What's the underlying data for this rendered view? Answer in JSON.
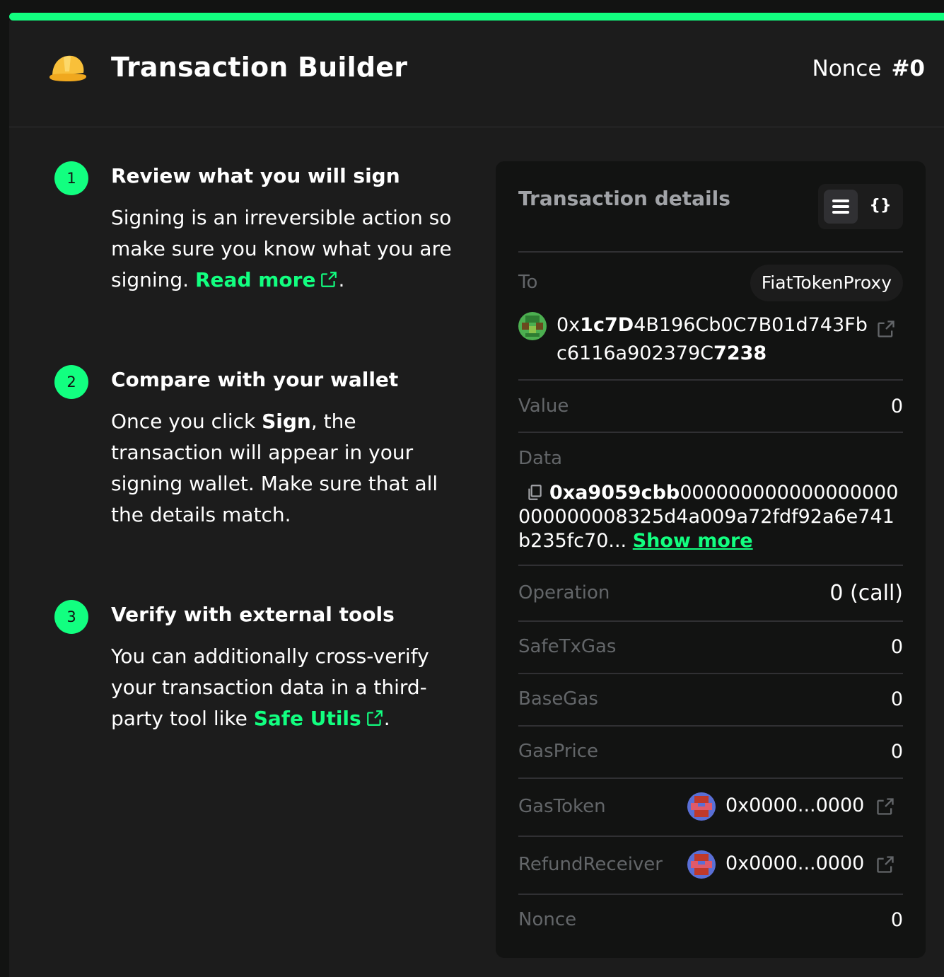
{
  "header": {
    "title": "Transaction Builder",
    "app_icon": "hard-hat-icon",
    "nonce_label": "Nonce",
    "nonce_value": "#0"
  },
  "steps": [
    {
      "number": "1",
      "title": "Review what you will sign",
      "body": "Signing is an irreversible action so make sure you know what you are signing.",
      "link": "Read more",
      "after": "."
    },
    {
      "number": "2",
      "title": "Compare with your wallet",
      "body_before": "Once you click",
      "body_bold": "Sign",
      "body_after": ", the transaction will appear in your signing wallet. Make sure that all the details match."
    },
    {
      "number": "3",
      "title": "Verify with external tools",
      "body": "You can additionally cross-verify your transaction data in a third-party tool like",
      "link": "Safe Utils",
      "after": "."
    }
  ],
  "details": {
    "title": "Transaction details",
    "to": {
      "label": "To",
      "name": "FiatTokenProxy",
      "addr_prefix": "0x",
      "addr_bold_start": "1c7D",
      "addr_middle": "4B196Cb0C7B01d743Fbc6116a902379C",
      "addr_bold_end": "7238"
    },
    "value": {
      "label": "Value",
      "value": "0"
    },
    "data": {
      "label": "Data",
      "hex_bold": "0xa9059cbb",
      "hex_rest": "000000000000000000000000008325d4a009a72fdf92a6e741b235fc70...",
      "show_more": "Show more"
    },
    "operation": {
      "label": "Operation",
      "value": "0 (call)"
    },
    "safe_tx_gas": {
      "label": "SafeTxGas",
      "value": "0"
    },
    "base_gas": {
      "label": "BaseGas",
      "value": "0"
    },
    "gas_price": {
      "label": "GasPrice",
      "value": "0"
    },
    "gas_token": {
      "label": "GasToken",
      "value": "0x0000...0000"
    },
    "refund_receiver": {
      "label": "RefundReceiver",
      "value": "0x0000...0000"
    },
    "nonce": {
      "label": "Nonce",
      "value": "0"
    }
  },
  "colors": {
    "accent": "#12ff80",
    "background": "#1c1c1c",
    "panel": "#121312",
    "muted": "#636669"
  }
}
